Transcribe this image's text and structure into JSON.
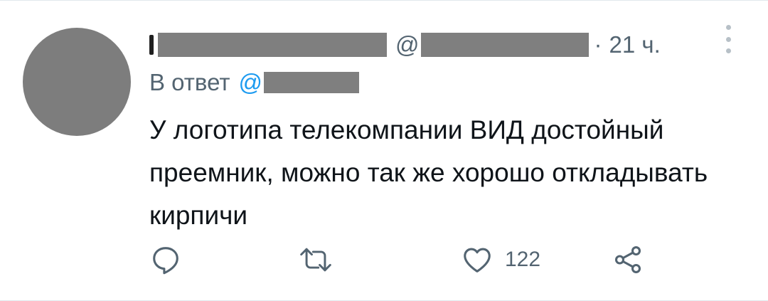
{
  "tweet": {
    "author_handle_prefix": "@",
    "separator": "·",
    "time": "21 ч.",
    "reply_prefix": "В ответ",
    "reply_handle_prefix": "@",
    "text": "У логотипа телекомпании ВИД достойный преемник, можно так же хорошо откладывать кирпичи",
    "likes": "122"
  },
  "icons": {
    "reply": "comment-icon",
    "retweet": "retweet-icon",
    "like": "heart-icon",
    "share": "share-icon",
    "more": "more-vertical-icon"
  },
  "colors": {
    "text": "#0f1419",
    "secondary": "#536471",
    "link": "#1d9bf0",
    "redaction": "#7f7f7f"
  }
}
